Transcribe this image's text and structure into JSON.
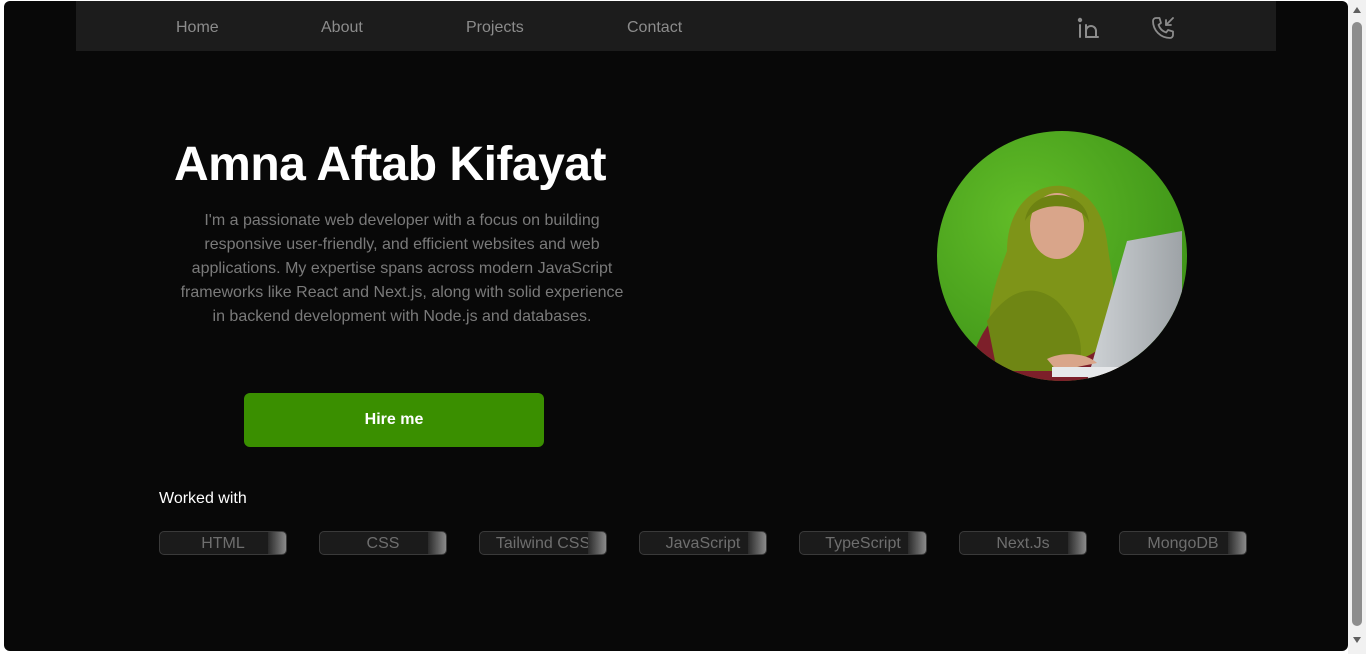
{
  "nav": {
    "links": [
      "Home",
      "About",
      "Projects",
      "Contact"
    ],
    "icons": [
      "linkedin-icon",
      "phone-incoming-icon"
    ]
  },
  "hero": {
    "name": "Amna Aftab Kifayat",
    "description": "I'm a passionate web developer with a focus on building responsive user-friendly, and efficient websites and web applications. My expertise spans across modern JavaScript frameworks like React and Next.js, along with solid experience in backend development with Node.js and databases.",
    "cta": "Hire me"
  },
  "skills": {
    "label": "Worked with",
    "items": [
      "HTML",
      "CSS",
      "Tailwind CSS",
      "JavaScript",
      "TypeScript",
      "Next.Js",
      "MongoDB"
    ]
  },
  "colors": {
    "background": "#080808",
    "navbar": "#1c1c1c",
    "accent": "#3a8f00",
    "muted_text": "#7a7a7a"
  }
}
